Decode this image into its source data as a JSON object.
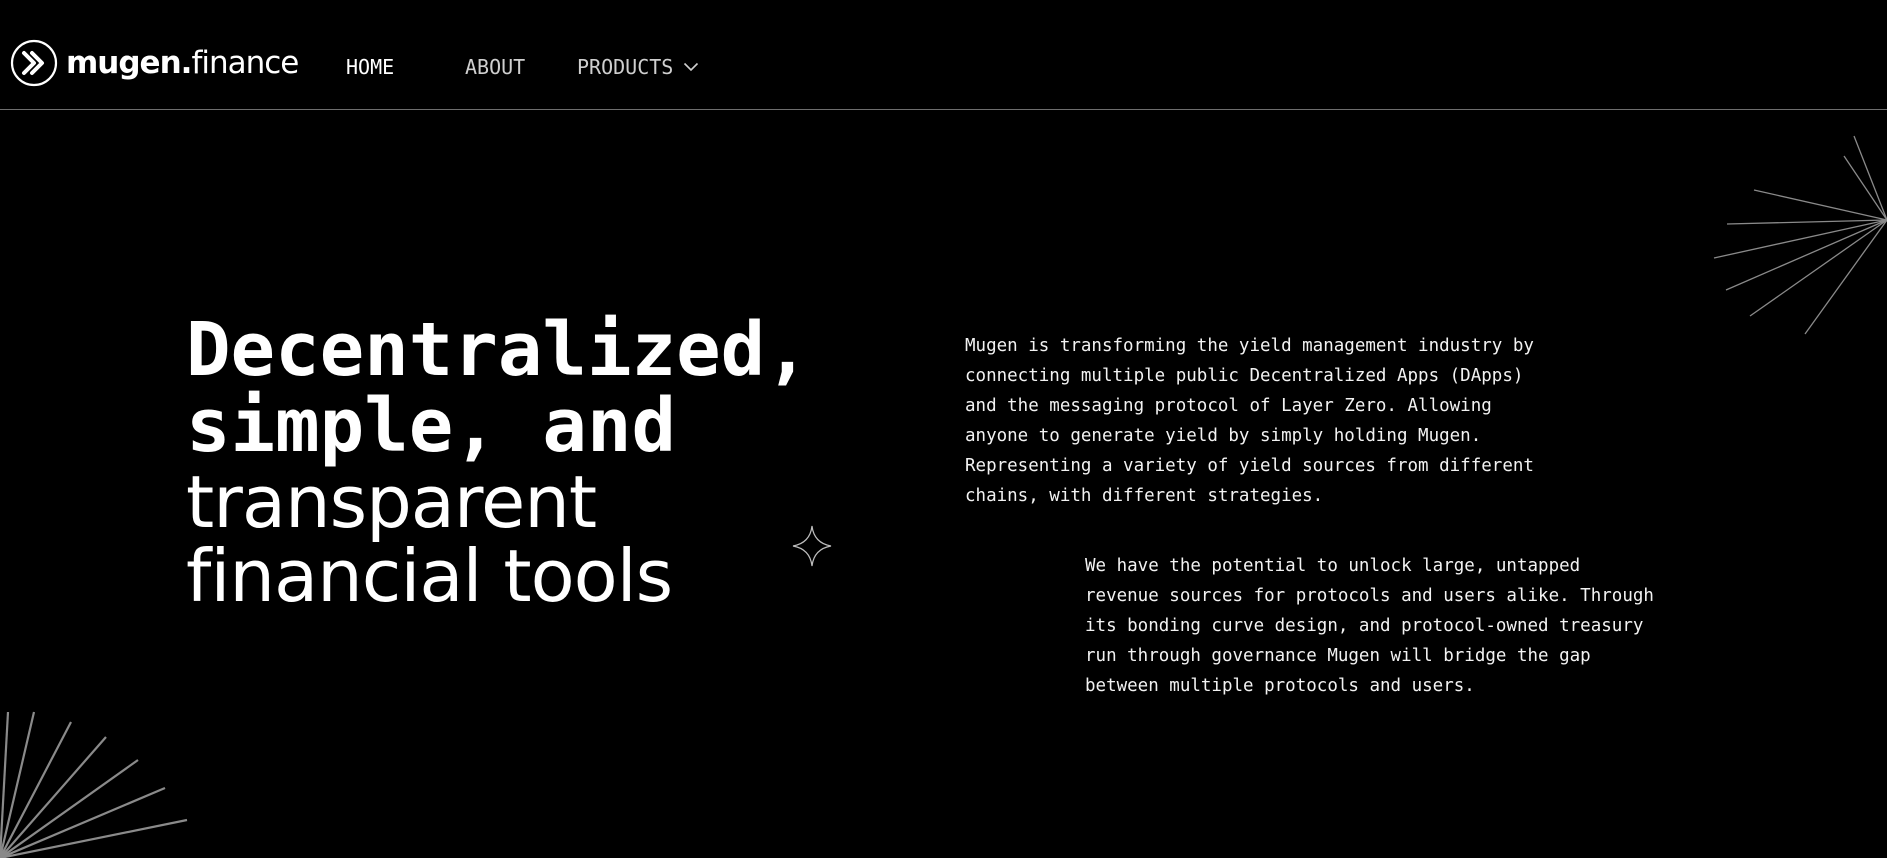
{
  "brand": {
    "name_bold": "mugen",
    "name_dot": ".",
    "name_light": "finance",
    "logo_icon": "double-chevron-circle-icon"
  },
  "nav": {
    "items": [
      {
        "label": "HOME",
        "active": true
      },
      {
        "label": "ABOUT",
        "active": false
      },
      {
        "label": "PRODUCTS",
        "active": false,
        "icon": "chevron-down-icon"
      }
    ]
  },
  "hero": {
    "title_bold_lines": [
      "Decentralized,",
      "simple, and"
    ],
    "title_light_lines": [
      "transparent",
      "financial tools"
    ],
    "paragraph_1_lines": [
      "Mugen is transforming the yield management industry by",
      "connecting multiple public Decentralized Apps (DApps)",
      "and the messaging protocol of Layer Zero. Allowing",
      "anyone to generate yield by simply holding Mugen.",
      "Representing a variety of yield sources from different",
      "chains, with different strategies."
    ],
    "paragraph_2_lines": [
      "We have the potential to unlock large, untapped",
      "revenue sources for protocols and users alike. Through",
      "its bonding curve design, and protocol-owned treasury",
      "run through governance Mugen will bridge the gap",
      "between multiple protocols and users."
    ]
  },
  "decor": {
    "sparkle": "four-point-star-icon",
    "burst": "radiating-lines-decoration"
  },
  "colors": {
    "background": "#000000",
    "text": "#ffffff",
    "nav_inactive": "#cfcfcf",
    "divider": "#6e6e6e",
    "burst_lines": "#8a8a8a"
  }
}
